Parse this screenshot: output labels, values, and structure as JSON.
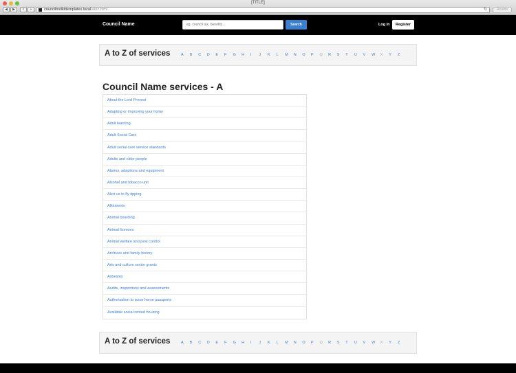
{
  "browser": {
    "window_title": "[TITLE]",
    "url_host": "counciltoolkittemplates.local",
    "url_path": "/atoz.html",
    "reader_label": "Reader"
  },
  "header": {
    "site_name": "Council Name",
    "search_placeholder": "eg. council tax, benefits...",
    "search_label": "Search",
    "login_label": "Log In",
    "register_label": "Register"
  },
  "az": {
    "title": "A to Z of services",
    "letters": [
      "A",
      "B",
      "C",
      "D",
      "E",
      "F",
      "G",
      "H",
      "I",
      "J",
      "K",
      "L",
      "M",
      "N",
      "O",
      "P",
      "Q",
      "R",
      "S",
      "T",
      "U",
      "V",
      "W",
      "X",
      "Y",
      "Z"
    ],
    "disabled_letters": [
      "Q",
      "X"
    ]
  },
  "services": {
    "title": "Council Name services - A",
    "items": [
      "About the Lord Provost",
      "Adapting or improving your home",
      "Adult learning",
      "Adult Social Care",
      "Adult social care service standards",
      "Adults and older people",
      "Alarms, adaptions and equipment",
      "Alcohol and tobacco unit",
      "Alert us to fly tipping",
      "Allotments",
      "Animal boarding",
      "Animal licences",
      "Animal welfare and pest control",
      "Archives and family history",
      "Arts and culture sector grants",
      "Asbestos",
      "Audits, inspections and assessments",
      "Authorisation to issue horse passports",
      "Available social rented housing"
    ]
  },
  "colors": {
    "link": "#3a7fd0",
    "header_bg": "#000000",
    "az_bg": "#f4f4f4"
  }
}
